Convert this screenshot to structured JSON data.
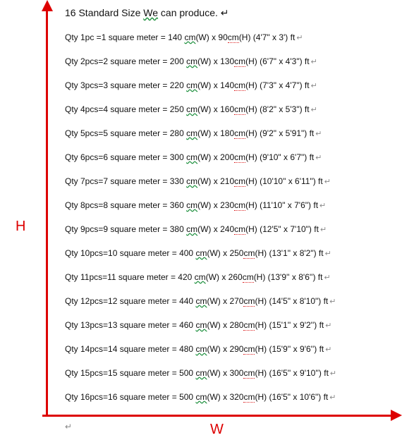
{
  "title_prefix": "16 Standard Size ",
  "title_We": "We",
  "title_suffix": " can produce.",
  "w_label": "W",
  "h_label": "H",
  "line_break": "↵",
  "chart_data": {
    "type": "table",
    "title": "16 Standard Size We can produce.",
    "xlabel": "W",
    "ylabel": "H",
    "columns": [
      "qty_pcs",
      "square_meter",
      "W_cm",
      "H_cm",
      "W_ft",
      "H_ft"
    ],
    "rows": [
      {
        "qty_pcs": 1,
        "square_meter": 1,
        "W_cm": 140,
        "H_cm": 90,
        "W_ft": "4'7\"",
        "H_ft": "3'"
      },
      {
        "qty_pcs": 2,
        "square_meter": 2,
        "W_cm": 200,
        "H_cm": 130,
        "W_ft": "6'7\"",
        "H_ft": "4'3\""
      },
      {
        "qty_pcs": 3,
        "square_meter": 3,
        "W_cm": 220,
        "H_cm": 140,
        "W_ft": "7'3\"",
        "H_ft": "4'7\""
      },
      {
        "qty_pcs": 4,
        "square_meter": 4,
        "W_cm": 250,
        "H_cm": 160,
        "W_ft": "8'2\"",
        "H_ft": "5'3\""
      },
      {
        "qty_pcs": 5,
        "square_meter": 5,
        "W_cm": 280,
        "H_cm": 180,
        "W_ft": "9'2\"",
        "H_ft": "5'91\""
      },
      {
        "qty_pcs": 6,
        "square_meter": 6,
        "W_cm": 300,
        "H_cm": 200,
        "W_ft": "9'10\"",
        "H_ft": "6'7\""
      },
      {
        "qty_pcs": 7,
        "square_meter": 7,
        "W_cm": 330,
        "H_cm": 210,
        "W_ft": "10'10\"",
        "H_ft": "6'11\""
      },
      {
        "qty_pcs": 8,
        "square_meter": 8,
        "W_cm": 360,
        "H_cm": 230,
        "W_ft": "11'10\"",
        "H_ft": "7'6\""
      },
      {
        "qty_pcs": 9,
        "square_meter": 9,
        "W_cm": 380,
        "H_cm": 240,
        "W_ft": "12'5\"",
        "H_ft": "7'10\""
      },
      {
        "qty_pcs": 10,
        "square_meter": 10,
        "W_cm": 400,
        "H_cm": 250,
        "W_ft": "13'1\"",
        "H_ft": "8'2\""
      },
      {
        "qty_pcs": 11,
        "square_meter": 11,
        "W_cm": 420,
        "H_cm": 260,
        "W_ft": "13'9''",
        "H_ft": "8'6''"
      },
      {
        "qty_pcs": 12,
        "square_meter": 12,
        "W_cm": 440,
        "H_cm": 270,
        "W_ft": "14'5\"",
        "H_ft": "8'10\""
      },
      {
        "qty_pcs": 13,
        "square_meter": 13,
        "W_cm": 460,
        "H_cm": 280,
        "W_ft": "15'1''",
        "H_ft": "9'2''"
      },
      {
        "qty_pcs": 14,
        "square_meter": 14,
        "W_cm": 480,
        "H_cm": 290,
        "W_ft": "15'9''",
        "H_ft": "9'6''"
      },
      {
        "qty_pcs": 15,
        "square_meter": 15,
        "W_cm": 500,
        "H_cm": 300,
        "W_ft": "16'5''",
        "H_ft": "9'10''"
      },
      {
        "qty_pcs": 16,
        "square_meter": 16,
        "W_cm": 500,
        "H_cm": 320,
        "W_ft": "16'5\"",
        "H_ft": "10'6\""
      }
    ]
  }
}
